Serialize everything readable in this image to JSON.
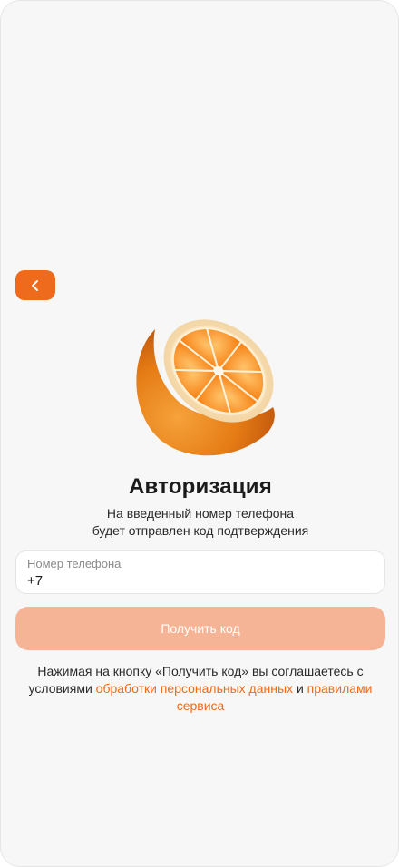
{
  "header": {
    "back_icon": "chevron-left-icon",
    "accent_color": "#EE6B1E"
  },
  "hero": {
    "image": "orange-slice-illustration"
  },
  "main": {
    "title": "Авторизация",
    "subtitle_line1": "На введенный номер телефона",
    "subtitle_line2": "будет отправлен код подтверждения"
  },
  "form": {
    "phone_label": "Номер телефона",
    "phone_value": "+7",
    "submit_label": "Получить код",
    "submit_color": "#F5B496"
  },
  "agreement": {
    "text_line1": "Нажимая на кнопку «Получить код» вы соглашаетесь с",
    "text_prefix2": "условиями",
    "link_privacy": "обработки персональных данных",
    "text_and": "и",
    "link_rules": "правилами сервиса"
  }
}
